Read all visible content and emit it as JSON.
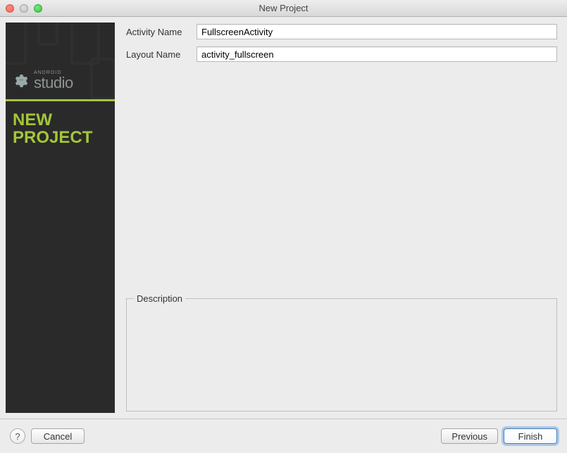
{
  "window": {
    "title": "New Project"
  },
  "sidebar": {
    "brand_small": "ANDROID",
    "brand_large": "studio",
    "heading": "NEW PROJECT"
  },
  "form": {
    "activity_label": "Activity Name",
    "activity_value": "FullscreenActivity",
    "layout_label": "Layout Name",
    "layout_value": "activity_fullscreen",
    "description_legend": "Description",
    "description_value": ""
  },
  "footer": {
    "help": "?",
    "cancel": "Cancel",
    "previous": "Previous",
    "finish": "Finish"
  }
}
